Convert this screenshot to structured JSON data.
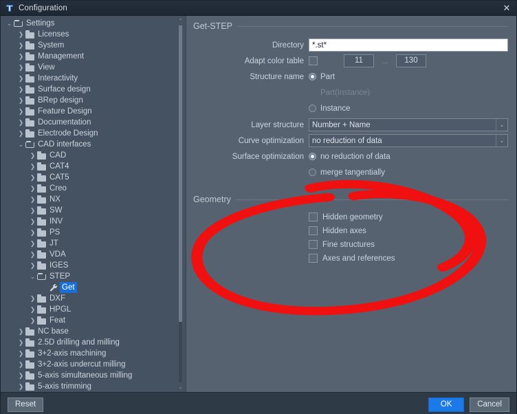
{
  "window": {
    "title": "Configuration",
    "close_label": "✕",
    "app_icon": "app-logo-icon"
  },
  "tree": {
    "items": [
      {
        "label": "Settings",
        "depth": 0,
        "twisty": "down",
        "icon": "folder-open-icon"
      },
      {
        "label": "Licenses",
        "depth": 1,
        "twisty": "right",
        "icon": "folder-icon"
      },
      {
        "label": "System",
        "depth": 1,
        "twisty": "right",
        "icon": "folder-icon"
      },
      {
        "label": "Management",
        "depth": 1,
        "twisty": "right",
        "icon": "folder-icon"
      },
      {
        "label": "View",
        "depth": 1,
        "twisty": "right",
        "icon": "folder-icon"
      },
      {
        "label": "Interactivity",
        "depth": 1,
        "twisty": "right",
        "icon": "folder-icon"
      },
      {
        "label": "Surface design",
        "depth": 1,
        "twisty": "right",
        "icon": "folder-icon"
      },
      {
        "label": "BRep design",
        "depth": 1,
        "twisty": "right",
        "icon": "folder-icon"
      },
      {
        "label": "Feature Design",
        "depth": 1,
        "twisty": "right",
        "icon": "folder-icon"
      },
      {
        "label": "Documentation",
        "depth": 1,
        "twisty": "right",
        "icon": "folder-icon"
      },
      {
        "label": "Electrode Design",
        "depth": 1,
        "twisty": "right",
        "icon": "folder-icon"
      },
      {
        "label": "CAD interfaces",
        "depth": 1,
        "twisty": "down",
        "icon": "folder-open-icon"
      },
      {
        "label": "CAD",
        "depth": 2,
        "twisty": "right",
        "icon": "folder-icon"
      },
      {
        "label": "CAT4",
        "depth": 2,
        "twisty": "right",
        "icon": "folder-icon"
      },
      {
        "label": "CAT5",
        "depth": 2,
        "twisty": "right",
        "icon": "folder-icon"
      },
      {
        "label": "Creo",
        "depth": 2,
        "twisty": "right",
        "icon": "folder-icon"
      },
      {
        "label": "NX",
        "depth": 2,
        "twisty": "right",
        "icon": "folder-icon"
      },
      {
        "label": "SW",
        "depth": 2,
        "twisty": "right",
        "icon": "folder-icon"
      },
      {
        "label": "INV",
        "depth": 2,
        "twisty": "right",
        "icon": "folder-icon"
      },
      {
        "label": "PS",
        "depth": 2,
        "twisty": "right",
        "icon": "folder-icon"
      },
      {
        "label": "JT",
        "depth": 2,
        "twisty": "right",
        "icon": "folder-icon"
      },
      {
        "label": "VDA",
        "depth": 2,
        "twisty": "right",
        "icon": "folder-icon"
      },
      {
        "label": "IGES",
        "depth": 2,
        "twisty": "right",
        "icon": "folder-icon"
      },
      {
        "label": "STEP",
        "depth": 2,
        "twisty": "down",
        "icon": "folder-open-icon"
      },
      {
        "label": "Get",
        "depth": 3,
        "twisty": "none",
        "icon": "wrench-icon",
        "selected": true
      },
      {
        "label": "DXF",
        "depth": 2,
        "twisty": "right",
        "icon": "folder-icon"
      },
      {
        "label": "HPGL",
        "depth": 2,
        "twisty": "right",
        "icon": "folder-icon"
      },
      {
        "label": "Feat",
        "depth": 2,
        "twisty": "right",
        "icon": "folder-icon"
      },
      {
        "label": "NC base",
        "depth": 1,
        "twisty": "right",
        "icon": "folder-icon"
      },
      {
        "label": "2.5D drilling and milling",
        "depth": 1,
        "twisty": "right",
        "icon": "folder-icon"
      },
      {
        "label": "3+2-axis machining",
        "depth": 1,
        "twisty": "right",
        "icon": "folder-icon"
      },
      {
        "label": "3+2-axis undercut milling",
        "depth": 1,
        "twisty": "right",
        "icon": "folder-icon"
      },
      {
        "label": "5-axis simultaneous milling",
        "depth": 1,
        "twisty": "right",
        "icon": "folder-icon"
      },
      {
        "label": "5-axis trimming",
        "depth": 1,
        "twisty": "right",
        "icon": "folder-icon"
      }
    ],
    "scroll_up_glyph": "⌃",
    "scroll_down_glyph": "⌄"
  },
  "get_step": {
    "group_title": "Get-STEP",
    "directory": {
      "label": "Directory",
      "value": "*.st*",
      "placeholder": ""
    },
    "adapt_color_table": {
      "label": "Adapt color table",
      "checked": false,
      "from": "11",
      "separator": "...",
      "to": "130"
    },
    "structure_name": {
      "label": "Structure name",
      "options": [
        {
          "label": "Part",
          "selected": true,
          "disabled": false
        },
        {
          "label": "Part(Instance)",
          "selected": false,
          "disabled": true
        },
        {
          "label": "Instance",
          "selected": false,
          "disabled": false
        }
      ]
    },
    "layer_structure": {
      "label": "Layer structure",
      "value": "Number + Name",
      "arrow": "⌄"
    },
    "curve_optimization": {
      "label": "Curve optimization",
      "value": "no reduction of data",
      "arrow": "⌄"
    },
    "surface_optimization": {
      "label": "Surface optimization",
      "options": [
        {
          "label": "no reduction of data",
          "selected": true
        },
        {
          "label": "merge tangentially",
          "selected": false
        }
      ]
    }
  },
  "geometry": {
    "group_title": "Geometry",
    "checkboxes": [
      {
        "label": "Hidden geometry",
        "checked": false
      },
      {
        "label": "Hidden axes",
        "checked": false
      },
      {
        "label": "Fine structures",
        "checked": false
      },
      {
        "label": "Axes and references",
        "checked": false
      }
    ]
  },
  "footer": {
    "reset_label": "Reset",
    "ok_label": "OK",
    "cancel_label": "Cancel"
  },
  "annotation": {
    "shape": "red-ellipse-highlight",
    "color": "#f01010"
  },
  "colors": {
    "accent": "#1c7ae8",
    "selection": "#1a6fd4",
    "panel": "#566270",
    "tree_panel": "#455261",
    "titlebar": "#1e2834",
    "annotation_red": "#f01010"
  }
}
